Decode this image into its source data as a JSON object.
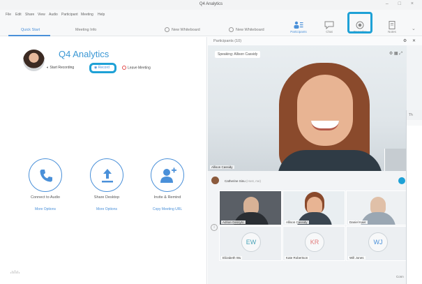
{
  "window": {
    "title": "Q4 Analytics",
    "controls": "– □ ×"
  },
  "menu": {
    "items": [
      "File",
      "Edit",
      "Share",
      "View",
      "Audio",
      "Participant",
      "Meeting",
      "Help"
    ]
  },
  "toolbar": {
    "tabs": [
      "Quick Start",
      "Meeting Info"
    ],
    "buttons": [
      "New Whiteboard",
      "New Whiteboard"
    ],
    "nav": {
      "participants": "Participants",
      "chat": "Chat",
      "recorder": "Recorder",
      "notes": "Notes"
    }
  },
  "meeting": {
    "title": "Q4 Analytics",
    "start_recording": "Start Recording",
    "record": "Record",
    "leave": "Leave Meeting"
  },
  "actions": [
    {
      "label": "Connect to Audio",
      "link": "More Options",
      "icon": "phone-icon"
    },
    {
      "label": "Share Desktop",
      "link": "More Options",
      "icon": "upload-icon"
    },
    {
      "label": "Invite & Remind",
      "link": "Copy Meeting URL",
      "icon": "add-user-icon"
    }
  ],
  "branding": {
    "logo": "cisco"
  },
  "participants_panel": {
    "header": "Participants (10)",
    "icons": "⚙ ✕",
    "speaking": "Speaking: Allison Cassidy",
    "video_name": "Allison Cassidy",
    "presenter_name": "Catherine Sinu",
    "presenter_role": "(Host, me)",
    "tiles": [
      {
        "name": "Adrian Dessyto",
        "type": "photo"
      },
      {
        "name": "Allison Cassidy",
        "type": "photo"
      },
      {
        "name": "Daniel Kaer",
        "type": "photo"
      },
      {
        "name": "Elizabeth Wu",
        "type": "initials",
        "initials": "EW"
      },
      {
        "name": "Kate Robertson",
        "type": "initials",
        "initials": "KR"
      },
      {
        "name": "Will Jones",
        "type": "initials",
        "initials": "WJ"
      }
    ]
  },
  "side_window": {
    "title": "Th",
    "bottom": "Conn"
  },
  "colors": {
    "accent": "#4a90d9",
    "highlight": "#1ea1d6",
    "leave": "#e24b4b"
  }
}
